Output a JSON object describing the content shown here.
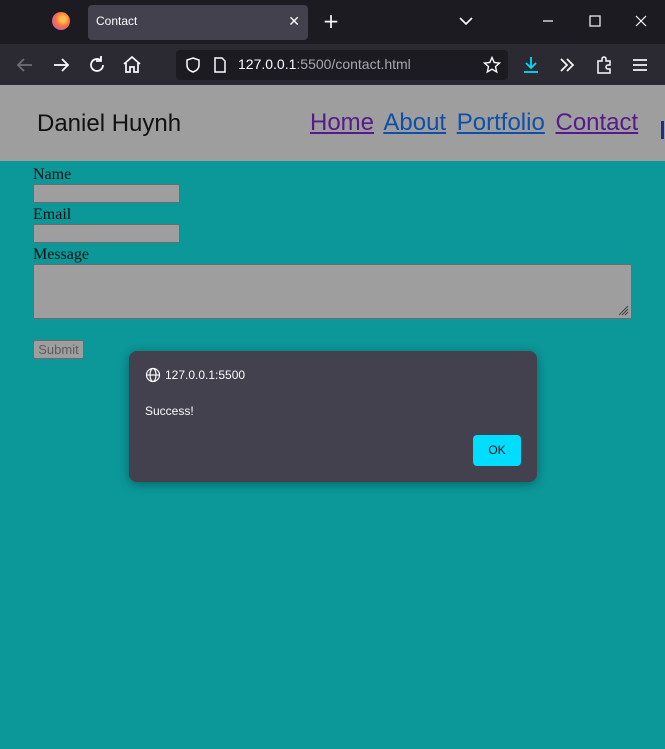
{
  "browser": {
    "tab_title": "Contact",
    "tab_close_glyph": "✕",
    "new_tab_glyph": "+",
    "url_host": "127.0.0.1",
    "url_rest": ":5500/contact.html",
    "icons": [
      "firefox-logo-icon",
      "back-icon",
      "forward-icon",
      "reload-icon",
      "home-icon",
      "shield-icon",
      "page-icon",
      "bookmark-star-icon",
      "download-icon",
      "overflow-icon",
      "extensions-icon",
      "menu-icon",
      "list-all-tabs-icon",
      "minimize-icon",
      "maximize-icon",
      "close-window-icon"
    ]
  },
  "site": {
    "brand": "Daniel Huynh",
    "nav": [
      {
        "label": "Home"
      },
      {
        "label": "About"
      },
      {
        "label": "Portfolio"
      },
      {
        "label": "Contact"
      }
    ]
  },
  "form": {
    "name_label": "Name",
    "email_label": "Email",
    "message_label": "Message",
    "name_value": "",
    "email_value": "",
    "message_value": "",
    "submit_label": "Submit"
  },
  "dialog": {
    "origin": "127.0.0.1:5500",
    "message": "Success!",
    "ok_label": "OK"
  },
  "colors": {
    "page_background": "#0c9799",
    "header_background": "#9e9e9e",
    "dialog_background": "#42414d",
    "ok_button": "#00ddff",
    "link_visited": "#551a8b",
    "link_normal": "#0f4fa8"
  }
}
